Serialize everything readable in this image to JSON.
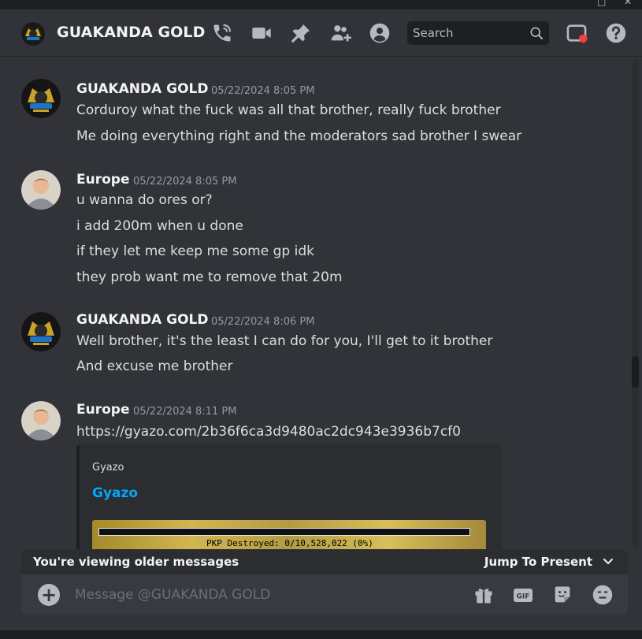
{
  "window": {
    "maximize_glyph": "□",
    "close_glyph": "✕"
  },
  "header": {
    "title": "GUAKANDA GOLD",
    "icons": [
      "phone-call-icon",
      "video-icon",
      "pin-icon",
      "add-friend-icon",
      "profile-icon",
      "inbox-icon",
      "help-icon"
    ],
    "search_placeholder": "Search"
  },
  "messages": [
    {
      "author": "GUAKANDA GOLD",
      "timestamp": "05/22/2024 8:05 PM",
      "lines": [
        "Corduroy what the fuck was all that brother, really fuck brother",
        "Me doing everything right and the moderators sad brother I swear"
      ]
    },
    {
      "author": "Europe",
      "timestamp": "05/22/2024 8:05 PM",
      "lines": [
        "u wanna do ores or?",
        "i add 200m when u done",
        "if they let me keep me some gp idk",
        "they prob want me to remove that 20m"
      ]
    },
    {
      "author": "GUAKANDA GOLD",
      "timestamp": "05/22/2024 8:06 PM",
      "lines": [
        "Well brother, it's the least I can do for you, I'll get to it brother",
        "And excuse me brother"
      ]
    },
    {
      "author": "Europe",
      "timestamp": "05/22/2024 8:11 PM",
      "link": "https://gyazo.com/2b36f6ca3d9480ac2dc943e3936b7cf0",
      "embed": {
        "provider": "Gyazo",
        "title": "Gyazo",
        "image_text": "PKP Destroyed: 0/10,528,022 (0%)"
      }
    }
  ],
  "older_bar": {
    "text": "You're viewing older messages",
    "jump_label": "Jump To Present"
  },
  "composer": {
    "placeholder": "Message @GUAKANDA GOLD",
    "gif_label": "GIF",
    "icons": [
      "add-icon",
      "gift-icon",
      "gif-icon",
      "sticker-icon",
      "emoji-icon"
    ]
  },
  "colors": {
    "background": "#313338",
    "link": "#00a8fc",
    "notification_dot": "#f23f43"
  }
}
